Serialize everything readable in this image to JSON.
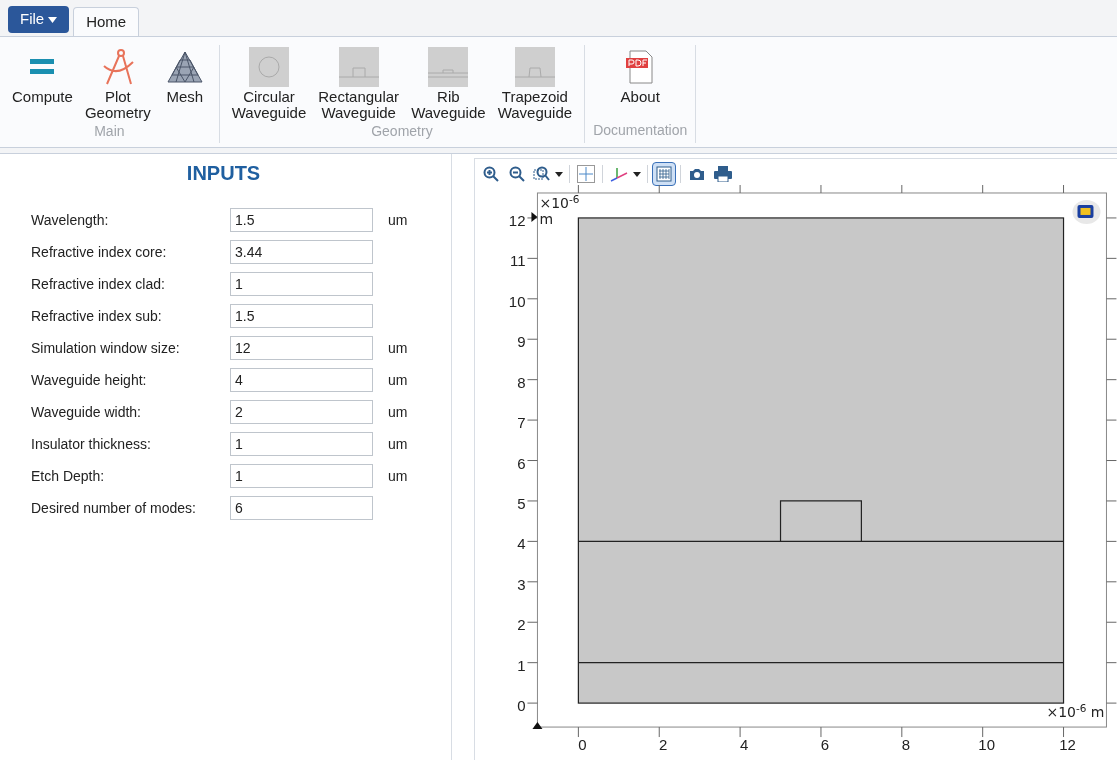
{
  "menu": {
    "file": "File",
    "tabs": [
      {
        "label": "Home",
        "selected": true
      }
    ]
  },
  "ribbon": {
    "groups": [
      {
        "label": "Main",
        "buttons": [
          {
            "label": "Compute",
            "kind": "compute"
          },
          {
            "label": "Plot\nGeometry",
            "kind": "compass"
          },
          {
            "label": "Mesh",
            "kind": "mesh"
          }
        ]
      },
      {
        "label": "Geometry",
        "buttons": [
          {
            "label": "Circular\nWaveguide",
            "kind": "circular"
          },
          {
            "label": "Rectangular\nWaveguide",
            "kind": "rectangular"
          },
          {
            "label": "Rib\nWaveguide",
            "kind": "rib"
          },
          {
            "label": "Trapezoid\nWaveguide",
            "kind": "trapezoid"
          }
        ]
      },
      {
        "label": "Documentation",
        "buttons": [
          {
            "label": "About",
            "kind": "pdf"
          }
        ]
      }
    ]
  },
  "inputs": {
    "title": "INPUTS",
    "fields": [
      {
        "label": "Wavelength:",
        "value": "1.5",
        "unit": "um"
      },
      {
        "label": "Refractive index core:",
        "value": "3.44"
      },
      {
        "label": "Refractive index clad:",
        "value": "1"
      },
      {
        "label": "Refractive index sub:",
        "value": "1.5"
      },
      {
        "label": "Simulation window size:",
        "value": "12",
        "unit": "um"
      },
      {
        "label": "Waveguide height:",
        "value": "4",
        "unit": "um"
      },
      {
        "label": "Waveguide width:",
        "value": "2",
        "unit": "um"
      },
      {
        "label": "Insulator thickness:",
        "value": "1",
        "unit": "um"
      },
      {
        "label": "Etch Depth:",
        "value": "1",
        "unit": "um"
      },
      {
        "label": "Desired number of modes:",
        "value": "6"
      }
    ]
  },
  "plot": {
    "toolbar": [
      {
        "kind": "zoom-in"
      },
      {
        "kind": "zoom-out"
      },
      {
        "kind": "zoom-box"
      },
      {
        "kind": "extents"
      },
      {
        "kind": "axes"
      },
      {
        "kind": "grid",
        "selected": true
      },
      {
        "kind": "camera"
      },
      {
        "kind": "print"
      }
    ],
    "y_scale": "×10$^{-6}$",
    "y_unit": "m",
    "x_unit": "×10$^{-6}$ m",
    "x_ticks": [
      "0",
      "2",
      "4",
      "6",
      "8",
      "10",
      "12"
    ],
    "y_ticks": [
      "12",
      "11",
      "10",
      "9",
      "8",
      "7",
      "6",
      "5",
      "4",
      "3",
      "2",
      "1",
      "0"
    ]
  }
}
